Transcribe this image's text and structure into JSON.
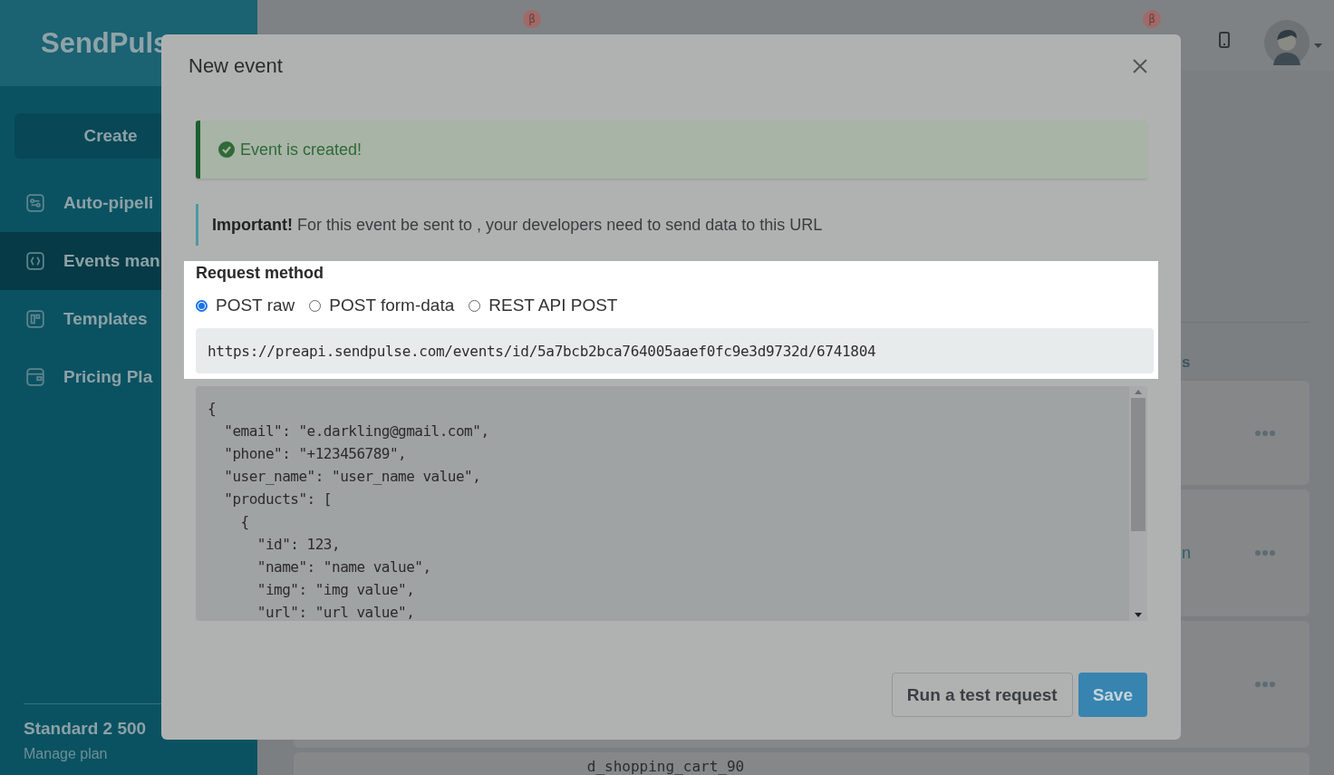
{
  "app": {
    "logo": "SendPuls"
  },
  "sidebar": {
    "create_button": "Create",
    "items": [
      {
        "label": "Auto-pipeli",
        "selected": false
      },
      {
        "label": "Events man",
        "selected": true
      },
      {
        "label": "Templates",
        "selected": false
      },
      {
        "label": "Pricing Pla",
        "selected": false
      }
    ],
    "plan": {
      "name": "Standard 2 500",
      "link": "Manage plan"
    }
  },
  "topbar": {
    "badges": [
      "β",
      "β"
    ]
  },
  "background": {
    "heading_fragment": "s",
    "cards": [
      {
        "kind": "blank"
      },
      {
        "kind": "named",
        "fragment": "n"
      },
      {
        "kind": "blank"
      }
    ],
    "footer_text": "d_shopping_cart_90"
  },
  "modal": {
    "title": "New event",
    "success": "Event is created!",
    "info": "**Important!** For this event be sent to , your developers need to send data to this URL",
    "request_method": {
      "label": "Request method",
      "options": [
        {
          "label": "POST raw",
          "selected": true
        },
        {
          "label": "POST form-data",
          "selected": false
        },
        {
          "label": "REST API POST",
          "selected": false
        }
      ]
    },
    "url": "https://preapi.sendpulse.com/events/id/5a7bcb2bca764005aaef0fc9e3d9732d/6741804",
    "code_lines": [
      "{",
      "  \"email\": \"e.darkling@gmail.com\",",
      "  \"phone\": \"+123456789\",",
      "  \"user_name\": \"user_name value\",",
      "  \"products\": [",
      "    {",
      "      \"id\": 123,",
      "      \"name\": \"name value\",",
      "      \"img\": \"img value\",",
      "      \"url\": \"url value\","
    ],
    "buttons": [
      {
        "label": "Run a test request",
        "kind": "secondary"
      },
      {
        "label": "Save",
        "kind": "primary"
      }
    ]
  }
}
